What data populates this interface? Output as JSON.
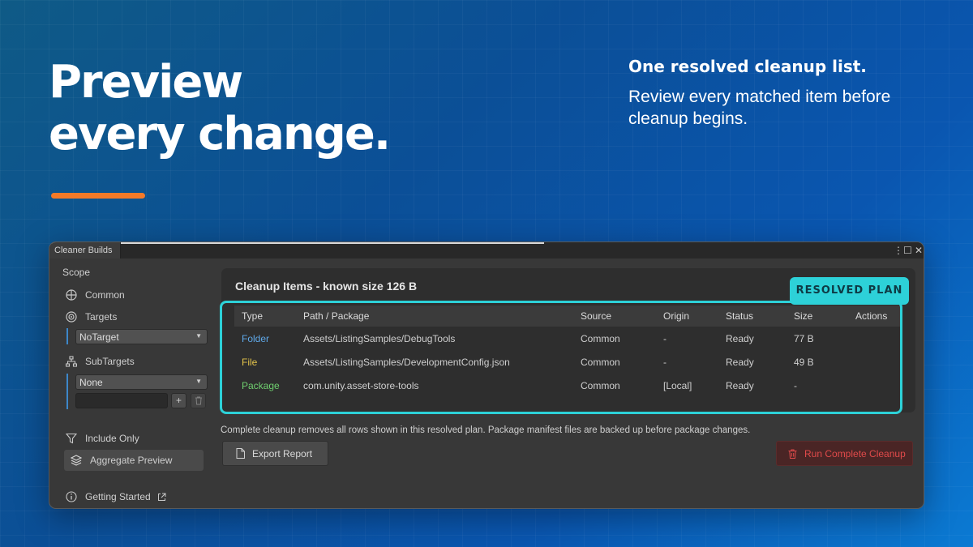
{
  "hero": {
    "line1": "Preview",
    "line2": "every change.",
    "accent_color": "#f47a28"
  },
  "tagline": {
    "title": "One resolved cleanup list.",
    "body": "Review every matched item before cleanup begins."
  },
  "window": {
    "tab_title": "Cleaner Builds",
    "controls": {
      "menu": "⋮",
      "maximize": "☐",
      "close": "✕"
    }
  },
  "sidebar": {
    "scope_label": "Scope",
    "common": "Common",
    "targets": "Targets",
    "targets_select": "NoTarget",
    "subtargets": "SubTargets",
    "subtargets_select": "None",
    "add_button": "+",
    "include_only": "Include Only",
    "aggregate_preview": "Aggregate Preview",
    "getting_started": "Getting Started"
  },
  "panel": {
    "title": "Cleanup Items - known size 126 B",
    "badge": "RESOLVED PLAN",
    "columns": [
      "Type",
      "Path / Package",
      "Source",
      "Origin",
      "Status",
      "Size",
      "Actions"
    ],
    "rows": [
      {
        "type": "Folder",
        "type_color": "#5fa8e8",
        "path": "Assets/ListingSamples/DebugTools",
        "source": "Common",
        "origin": "-",
        "status": "Ready",
        "size": "77 B"
      },
      {
        "type": "File",
        "type_color": "#e2c24a",
        "path": "Assets/ListingSamples/DevelopmentConfig.json",
        "source": "Common",
        "origin": "-",
        "status": "Ready",
        "size": "49 B"
      },
      {
        "type": "Package",
        "type_color": "#6fcf6f",
        "path": "com.unity.asset-store-tools",
        "source": "Common",
        "origin": "[Local]",
        "status": "Ready",
        "size": "-"
      }
    ]
  },
  "footer": {
    "note": "Complete cleanup removes all rows shown in this resolved plan. Package manifest files are backed up before package changes.",
    "export_label": "Export Report",
    "run_label": "Run Complete Cleanup"
  },
  "colors": {
    "highlight": "#2dd1d8",
    "danger": "#e04a4a"
  }
}
